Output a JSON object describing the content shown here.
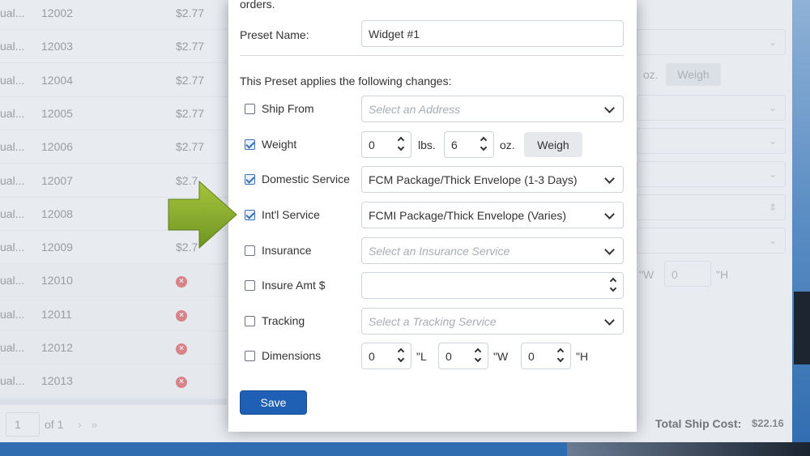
{
  "background": {
    "rows": [
      {
        "c1": "ual...",
        "id": "12002",
        "c3": "$2.77",
        "error": false
      },
      {
        "c1": "ual...",
        "id": "12003",
        "c3": "$2.77",
        "error": false
      },
      {
        "c1": "ual...",
        "id": "12004",
        "c3": "$2.77",
        "error": false
      },
      {
        "c1": "ual...",
        "id": "12005",
        "c3": "$2.77",
        "error": false
      },
      {
        "c1": "ual...",
        "id": "12006",
        "c3": "$2.77",
        "error": false
      },
      {
        "c1": "ual...",
        "id": "12007",
        "c3": "$2.7",
        "error": false
      },
      {
        "c1": "ual...",
        "id": "12008",
        "c3": "$2.",
        "error": false
      },
      {
        "c1": "ual...",
        "id": "12009",
        "c3": "$2.7",
        "error": false
      },
      {
        "c1": "ual...",
        "id": "12010",
        "c3": "",
        "error": true
      },
      {
        "c1": "ual...",
        "id": "12011",
        "c3": "",
        "error": true
      },
      {
        "c1": "ual...",
        "id": "12012",
        "c3": "",
        "error": true
      },
      {
        "c1": "ual...",
        "id": "12013",
        "c3": "",
        "error": true
      }
    ],
    "pager": {
      "page": "1",
      "of_label": "of 1",
      "next_glyph": "› »"
    },
    "right": {
      "oz": "oz.",
      "weigh": "Weigh",
      "dim_w_unit": "\"W",
      "dim_h_value": "0",
      "dim_h_unit": "\"H",
      "total_label": "Total Ship Cost:",
      "total_value": "$22.16"
    }
  },
  "modal": {
    "intro": "orders.",
    "preset_name_label": "Preset Name:",
    "preset_name_value": "Widget #1",
    "section_heading": "This Preset applies the following changes:",
    "rows": {
      "ship_from": {
        "label": "Ship From",
        "checked": false,
        "placeholder": "Select an Address"
      },
      "weight": {
        "label": "Weight",
        "checked": true,
        "lbs_value": "0",
        "lbs_unit": "lbs.",
        "oz_value": "6",
        "oz_unit": "oz.",
        "weigh_label": "Weigh"
      },
      "domestic": {
        "label": "Domestic Service",
        "checked": true,
        "value": "FCM Package/Thick Envelope (1-3 Days)"
      },
      "intl": {
        "label": "Int'l Service",
        "checked": true,
        "value": "FCMI Package/Thick Envelope (Varies)"
      },
      "insurance": {
        "label": "Insurance",
        "checked": false,
        "placeholder": "Select an Insurance Service"
      },
      "insure_amt": {
        "label": "Insure Amt $",
        "checked": false,
        "value": ""
      },
      "tracking": {
        "label": "Tracking",
        "checked": false,
        "placeholder": "Select a Tracking Service"
      },
      "dimensions": {
        "label": "Dimensions",
        "checked": false,
        "l_value": "0",
        "l_unit": "\"L",
        "w_value": "0",
        "w_unit": "\"W",
        "h_value": "0",
        "h_unit": "\"H"
      }
    },
    "save_label": "Save"
  },
  "colors": {
    "primary": "#1f5fb4",
    "check": "#3b6fb6",
    "arrow": "#8db12c",
    "error": "#e34b4b"
  }
}
